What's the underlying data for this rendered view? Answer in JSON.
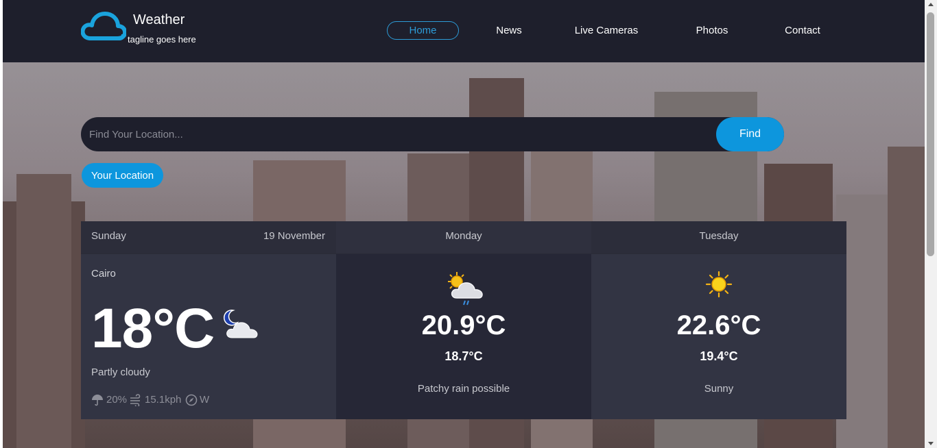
{
  "brand": {
    "title": "Weather",
    "tagline": "tagline goes here",
    "icon": "cloud-icon",
    "color": "#1aa3dd"
  },
  "nav": {
    "items": [
      {
        "label": "Home",
        "active": true
      },
      {
        "label": "News",
        "active": false
      },
      {
        "label": "Live Cameras",
        "active": false
      },
      {
        "label": "Photos",
        "active": false
      },
      {
        "label": "Contact",
        "active": false
      }
    ]
  },
  "search": {
    "placeholder": "Find Your Location...",
    "value": "",
    "button_label": "Find"
  },
  "location_button": {
    "label": "Your Location"
  },
  "colors": {
    "accent": "#0d96dd",
    "header_bg": "#1e1f2c",
    "card_bg": "#323443",
    "card_alt_bg": "#262736"
  },
  "today": {
    "day": "Sunday",
    "date": "19 November",
    "city": "Cairo",
    "temp": "18°C",
    "icon": "partly-cloudy-night-icon",
    "condition": "Partly cloudy",
    "rain_chance": "20%",
    "wind_speed": "15.1kph",
    "wind_dir": "W"
  },
  "forecast": [
    {
      "day": "Monday",
      "max": "20.9°C",
      "min": "18.7°C",
      "condition": "Patchy rain possible",
      "icon": "sun-cloud-rain-icon"
    },
    {
      "day": "Tuesday",
      "max": "22.6°C",
      "min": "19.4°C",
      "condition": "Sunny",
      "icon": "sun-icon"
    }
  ]
}
